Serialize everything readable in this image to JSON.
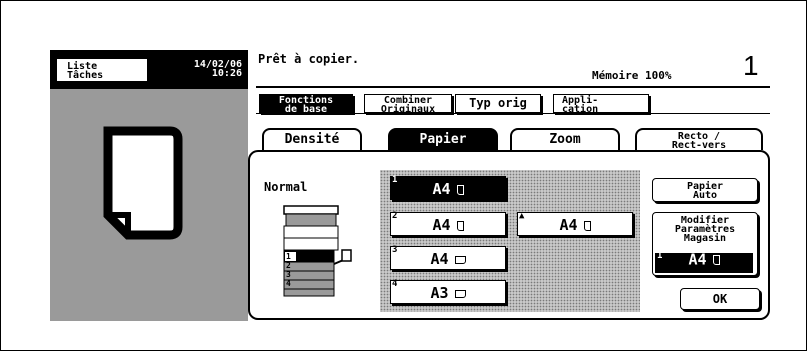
{
  "header": {
    "jobs_button": "Liste\nTâches",
    "date": "14/02/06",
    "time": "10:26",
    "status": "Prêt à copier.",
    "memory": "Mémoire 100%",
    "copy_count": "1"
  },
  "function_tabs": [
    {
      "label": "Fonctions\nde base",
      "selected": true
    },
    {
      "label": "Combiner\nOriginaux",
      "selected": false
    },
    {
      "label": "Typ orig",
      "selected": false
    },
    {
      "label": "Appli-\ncation",
      "selected": false
    }
  ],
  "sub_tabs": [
    {
      "label": "Densité",
      "selected": false
    },
    {
      "label": "Papier",
      "selected": true
    },
    {
      "label": "Zoom",
      "selected": false
    },
    {
      "label": "Recto /\nRect-vers",
      "selected": false
    }
  ],
  "panel": {
    "mode_label": "Normal",
    "trays": [
      {
        "number": "1",
        "label": "A4",
        "orientation": "portrait",
        "selected": true
      },
      {
        "number": "2",
        "label": "A4",
        "orientation": "portrait",
        "selected": false
      },
      {
        "number": "3",
        "label": "A4",
        "orientation": "landscape",
        "selected": false
      },
      {
        "number": "4",
        "label": "A3",
        "orientation": "landscape",
        "selected": false
      },
      {
        "number": "▲",
        "label": "A4",
        "orientation": "portrait",
        "selected": false
      }
    ],
    "paper_auto": "Papier\nAuto",
    "modify_params": "Modifier\nParamètres\nMagasin",
    "modify_tray": {
      "number": "1",
      "label": "A4"
    },
    "ok": "OK"
  },
  "machine_trays": [
    "1",
    "2",
    "3",
    "4"
  ],
  "colors": {
    "dots": "#c8c8c8",
    "gray": "#9a9a9a"
  }
}
